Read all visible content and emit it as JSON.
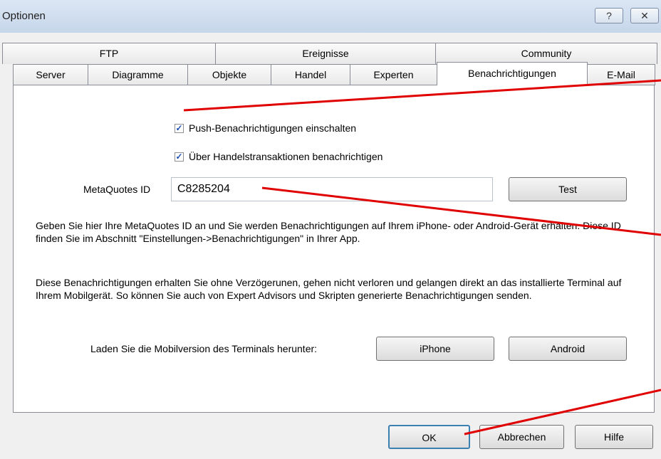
{
  "window": {
    "title": "Optionen",
    "help_glyph": "?",
    "close_glyph": "✕"
  },
  "tabs": {
    "row_top": [
      "FTP",
      "Ereignisse",
      "Community"
    ],
    "row_bottom": [
      "Server",
      "Diagramme",
      "Objekte",
      "Handel",
      "Experten",
      "Benachrichtigungen",
      "E-Mail"
    ],
    "active": "Benachrichtigungen"
  },
  "notifications": {
    "push_enabled_label": "Push-Benachrichtigungen einschalten",
    "push_enabled_checked": true,
    "trade_notify_label": "Über Handelstransaktionen benachrichtigen",
    "trade_notify_checked": true,
    "metaquotes_id_label": "MetaQuotes ID",
    "metaquotes_id_value": "C8285204",
    "test_button": "Test",
    "info_text_1": "Geben Sie hier Ihre MetaQuotes ID an und Sie werden Benachrichtigungen auf Ihrem iPhone- oder Android-Gerät erhalten. Diese ID finden Sie im Abschnitt \"Einstellungen->Benachrichtigungen\" in Ihrer App.",
    "info_text_2": "Diese Benachrichtigungen erhalten Sie ohne Verzögerunen, gehen nicht verloren und gelangen direkt an das installierte Terminal auf Ihrem Mobilgerät. So können Sie auch von Expert Advisors und Skripten generierte Benachrichtigungen senden.",
    "download_label": "Laden Sie die Mobilversion des Terminals herunter:",
    "iphone_button": "iPhone",
    "android_button": "Android"
  },
  "footer": {
    "ok": "OK",
    "cancel": "Abbrechen",
    "help": "Hilfe"
  },
  "colors": {
    "annotation_arrow": "#e00000",
    "check_mark": "#1c4eb0"
  }
}
